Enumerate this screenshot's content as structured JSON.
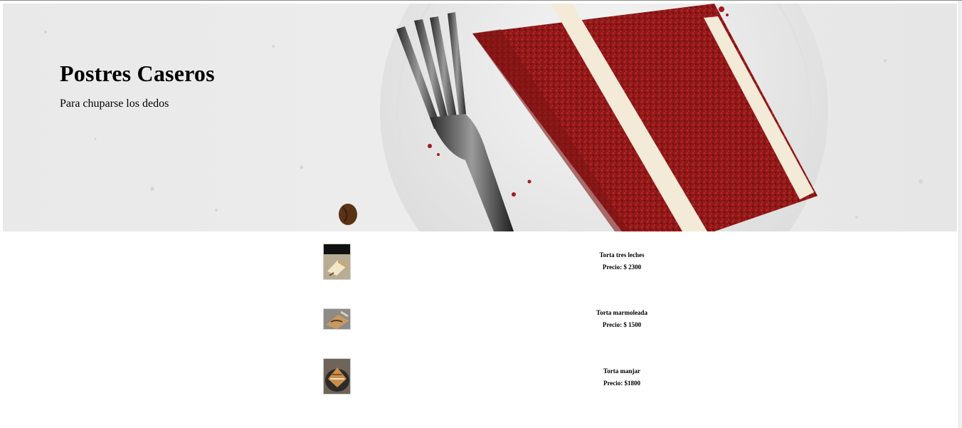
{
  "hero": {
    "title": "Postres Caseros",
    "subtitle": "Para chuparse los dedos",
    "image": "red-velvet-cake-slice-with-fork"
  },
  "products": [
    {
      "name": "Torta tres leches",
      "price": "Precio: $ 2300",
      "image": "tres-leches-cake-photo"
    },
    {
      "name": "Torta marmoleada",
      "price": "Precio: $ 1500",
      "image": "marble-cake-photo"
    },
    {
      "name": "Torta manjar",
      "price": "Precio: $1800",
      "image": "manjar-cake-photo"
    }
  ],
  "colors": {
    "cake_red": "#9b1c1c",
    "cream": "#f3ead8",
    "plate": "#f2f2f2",
    "background": "#ffffff"
  }
}
